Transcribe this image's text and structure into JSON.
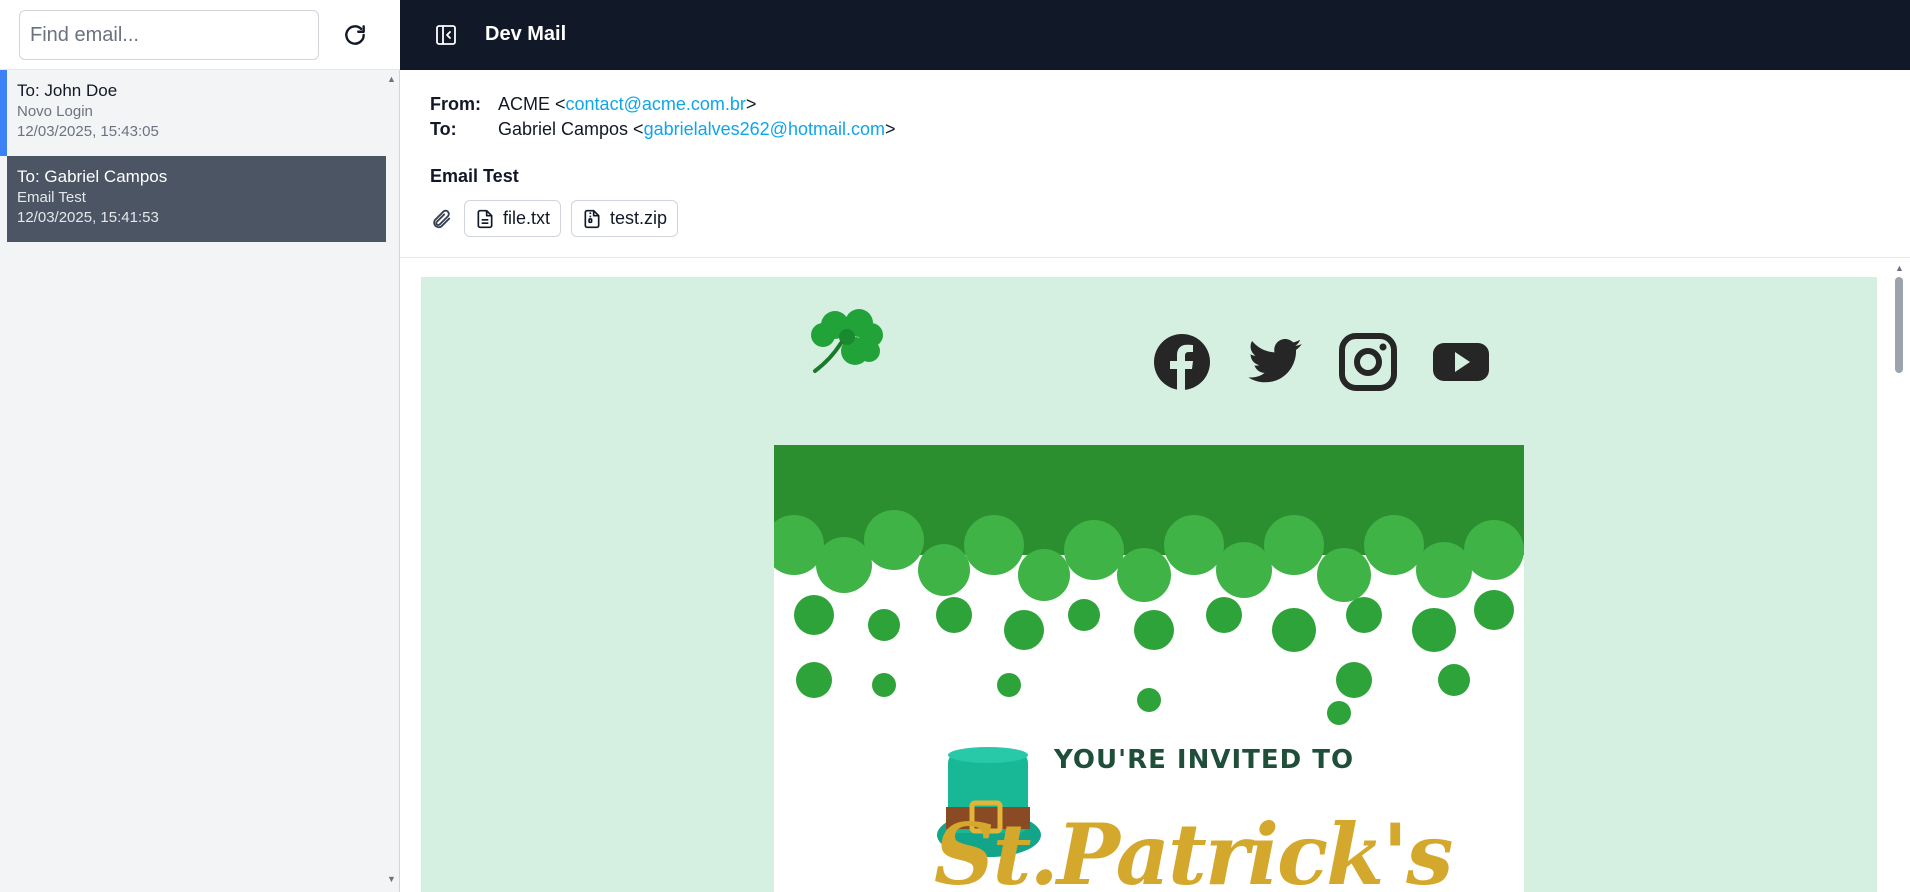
{
  "app": {
    "title": "Dev Mail"
  },
  "search": {
    "placeholder": "Find email..."
  },
  "emails": [
    {
      "to": "To: John Doe",
      "subject": "Novo Login",
      "date": "12/03/2025, 15:43:05"
    },
    {
      "to": "To: Gabriel Campos",
      "subject": "Email Test",
      "date": "12/03/2025, 15:41:53"
    }
  ],
  "message": {
    "from_label": "From:",
    "from_name": "ACME <",
    "from_email": "contact@acme.com.br",
    "from_close": ">",
    "to_label": "To:",
    "to_name": "Gabriel Campos <",
    "to_email": "gabrielalves262@hotmail.com",
    "to_close": ">",
    "subject": "Email Test",
    "attachments": [
      {
        "name": "file.txt",
        "icon": "file-text-icon"
      },
      {
        "name": "test.zip",
        "icon": "file-archive-icon"
      }
    ]
  },
  "body": {
    "invite_text": "YOU'RE INVITED TO",
    "script_text": "St.Patrick's",
    "social": [
      "facebook-icon",
      "twitter-icon",
      "instagram-icon",
      "youtube-icon"
    ]
  },
  "colors": {
    "header_bg": "#111827",
    "selected_bg": "#4b5563",
    "accent": "#3b82f6",
    "link": "#0ea5e9",
    "canvas_bg": "#d5f0e1"
  }
}
